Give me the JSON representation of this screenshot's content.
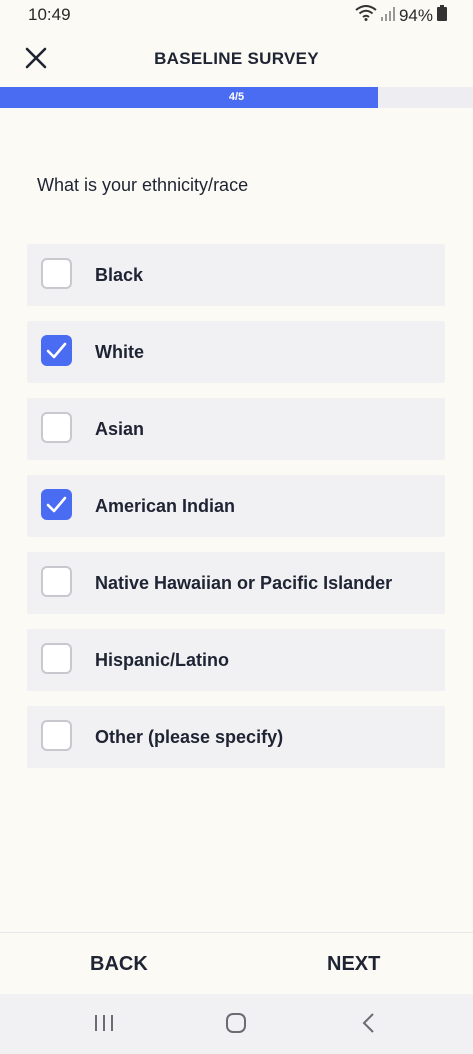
{
  "status_bar": {
    "time": "10:49",
    "battery": "94%",
    "icons": [
      "wifi-icon",
      "signal-icon",
      "battery-icon"
    ]
  },
  "header": {
    "title": "BASELINE SURVEY",
    "close_icon": "close-icon"
  },
  "progress": {
    "label": "4/5",
    "fill_fraction": 0.8,
    "color": "#4A6CF2"
  },
  "question": "What is your ethnicity/race",
  "options": [
    {
      "label": "Black",
      "checked": false
    },
    {
      "label": "White",
      "checked": true
    },
    {
      "label": "Asian",
      "checked": false
    },
    {
      "label": "American Indian",
      "checked": true
    },
    {
      "label": "Native Hawaiian or Pacific Islander",
      "checked": false
    },
    {
      "label": "Hispanic/Latino",
      "checked": false
    },
    {
      "label": "Other (please specify)",
      "checked": false
    }
  ],
  "footer": {
    "back_label": "BACK",
    "next_label": "NEXT"
  },
  "navbar": {
    "icons": [
      "recent-apps-icon",
      "home-icon",
      "back-icon"
    ]
  },
  "colors": {
    "accent": "#4A6CF2",
    "background": "#FCFAF4",
    "option_background": "#F1F0F3",
    "text": "#1E2433"
  }
}
